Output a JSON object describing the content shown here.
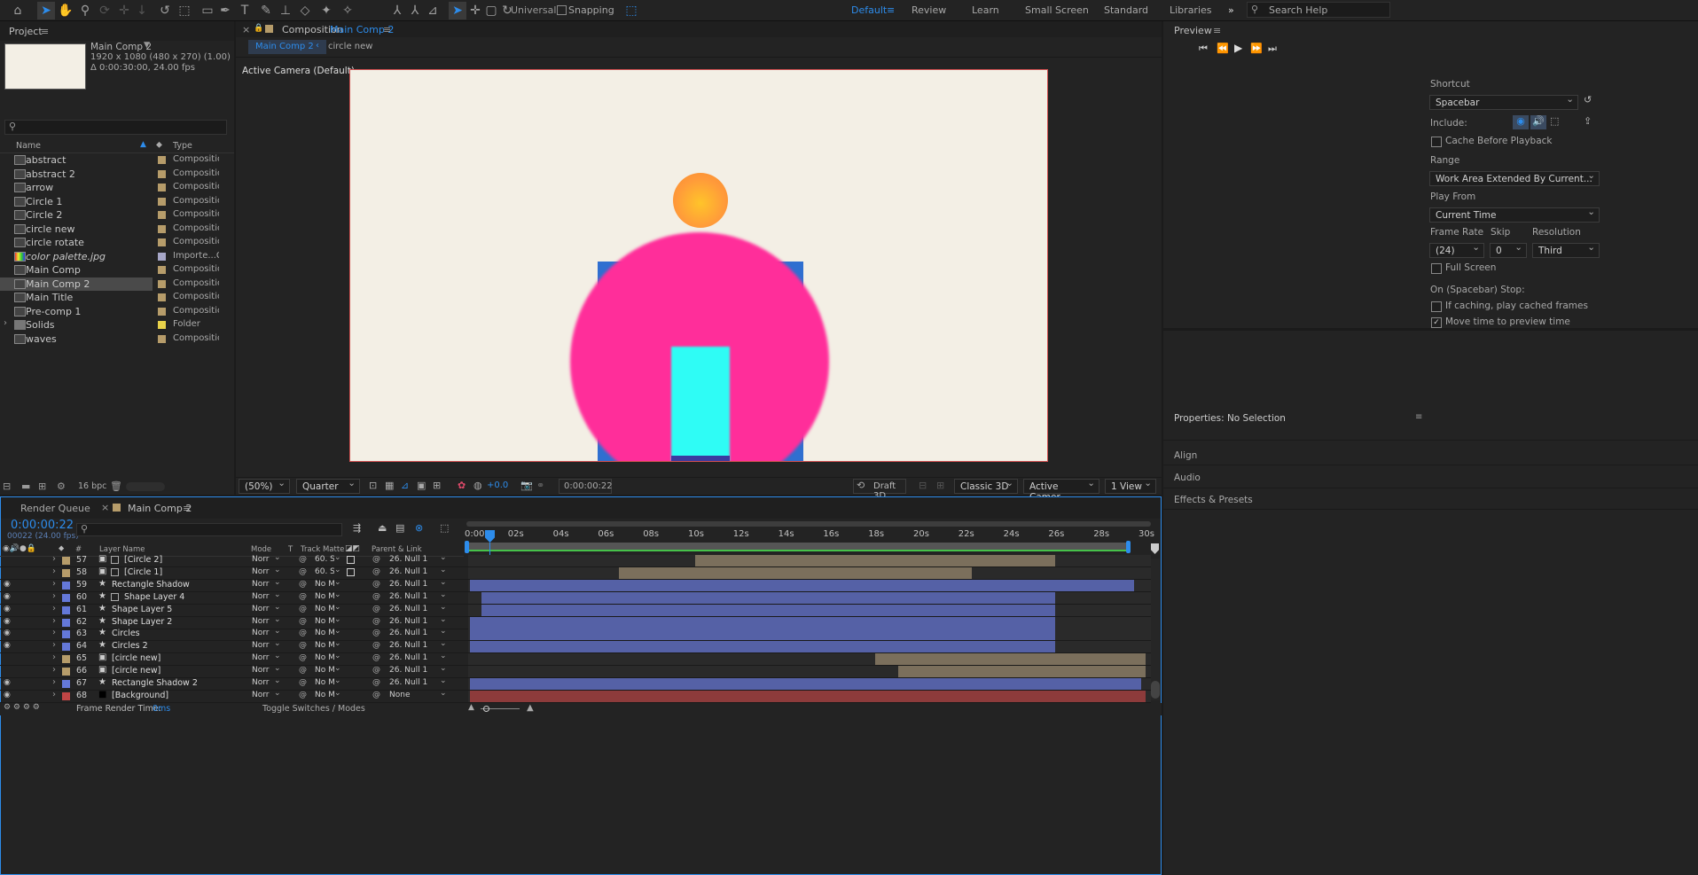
{
  "toolbar": {
    "mode_label": "Universal",
    "snapping_label": "Snapping",
    "workspaces": [
      "Default",
      "Review",
      "Learn",
      "Small Screen",
      "Standard",
      "Libraries"
    ],
    "search_placeholder": "Search Help"
  },
  "project": {
    "tab_label": "Project",
    "selected_name": "Main Comp 2",
    "selected_res": "1920 x 1080  (480 x 270) (1.00)",
    "selected_duration": "Δ 0:00:30:00, 24.00 fps",
    "col_name": "Name",
    "col_type": "Type",
    "items": [
      {
        "name": "abstract",
        "type": "Composition",
        "label_color": "#b69c6a"
      },
      {
        "name": "abstract 2",
        "type": "Composition",
        "label_color": "#b69c6a"
      },
      {
        "name": "arrow",
        "type": "Composition",
        "label_color": "#b69c6a"
      },
      {
        "name": "Circle 1",
        "type": "Composition",
        "label_color": "#b69c6a"
      },
      {
        "name": "Circle 2",
        "type": "Composition",
        "label_color": "#b69c6a"
      },
      {
        "name": "circle new",
        "type": "Composition",
        "label_color": "#b69c6a"
      },
      {
        "name": "circle rotate",
        "type": "Composition",
        "label_color": "#b69c6a"
      },
      {
        "name": "color palette.jpg",
        "type": "Importe...G",
        "label_color": "#a7a7c8"
      },
      {
        "name": "Main Comp",
        "type": "Composition",
        "label_color": "#b69c6a"
      },
      {
        "name": "Main Comp 2",
        "type": "Composition",
        "label_color": "#b69c6a"
      },
      {
        "name": "Main Title",
        "type": "Composition",
        "label_color": "#b69c6a"
      },
      {
        "name": "Pre-comp 1",
        "type": "Composition",
        "label_color": "#b69c6a"
      },
      {
        "name": "Solids",
        "type": "Folder",
        "label_color": "#e8d24a"
      },
      {
        "name": "waves",
        "type": "Composition",
        "label_color": "#b69c6a"
      }
    ],
    "bpc": "16 bpc"
  },
  "composition": {
    "tab_prefix": "Composition",
    "tab_name": "Main Comp 2",
    "breadcrumb_active": "Main Comp 2",
    "breadcrumb_next": "circle new",
    "camera_label": "Active Camera (Default)",
    "zoom": "(50%)",
    "resolution": "Quarter",
    "exposure": "+0.0",
    "timecode": "0:00:00:22",
    "draft3d": "Draft 3D",
    "renderer": "Classic 3D",
    "camera_select": "Active Camer...",
    "views": "1 View"
  },
  "preview": {
    "tab_label": "Preview",
    "shortcut_label": "Shortcut",
    "shortcut_value": "Spacebar",
    "include_label": "Include:",
    "cache_label": "Cache Before Playback",
    "range_label": "Range",
    "range_value": "Work Area Extended By Current...",
    "play_from_label": "Play From",
    "play_from_value": "Current Time",
    "frame_rate_label": "Frame Rate",
    "frame_rate_value": "(24)",
    "skip_label": "Skip",
    "skip_value": "0",
    "resolution_label": "Resolution",
    "resolution_value": "Third",
    "full_screen_label": "Full Screen",
    "on_stop_label": "On (Spacebar) Stop:",
    "if_caching_label": "If caching, play cached frames",
    "move_time_label": "Move time to preview time"
  },
  "properties": {
    "title": "Properties: No Selection",
    "sections": [
      "Align",
      "Audio",
      "Effects & Presets"
    ]
  },
  "timeline": {
    "tab_render_queue": "Render Queue",
    "tab_comp": "Main Comp 2",
    "timecode": "0:00:00:22",
    "frame_info": "00022 (24.00 fps)",
    "col_layer_name": "Layer Name",
    "col_mode": "Mode",
    "col_t": "T",
    "col_track_matte": "Track Matte",
    "col_parent": "Parent & Link",
    "ruler": [
      "0:00s",
      "02s",
      "04s",
      "06s",
      "08s",
      "10s",
      "12s",
      "14s",
      "16s",
      "18s",
      "20s",
      "22s",
      "24s",
      "26s",
      "28s",
      "30s"
    ],
    "layers": [
      {
        "num": "57",
        "name": "[Circle 2]",
        "mode": "Norr",
        "matte": "60. S",
        "parent": "26. Null 1",
        "label": "#b69c6a",
        "kind": "comp",
        "vis": false
      },
      {
        "num": "58",
        "name": "[Circle 1]",
        "mode": "Norr",
        "matte": "60. S",
        "parent": "26. Null 1",
        "label": "#b69c6a",
        "kind": "comp",
        "vis": false
      },
      {
        "num": "59",
        "name": "Rectangle Shadow",
        "mode": "Norr",
        "matte": "No M",
        "parent": "26. Null 1",
        "label": "#6478d8",
        "kind": "shape",
        "vis": true
      },
      {
        "num": "60",
        "name": "Shape Layer 4",
        "mode": "Norr",
        "matte": "No M",
        "parent": "26. Null 1",
        "label": "#6478d8",
        "kind": "shape",
        "vis": true
      },
      {
        "num": "61",
        "name": "Shape Layer 5",
        "mode": "Norr",
        "matte": "No M",
        "parent": "26. Null 1",
        "label": "#6478d8",
        "kind": "shape",
        "vis": true
      },
      {
        "num": "62",
        "name": "Shape Layer 2",
        "mode": "Norr",
        "matte": "No M",
        "parent": "26. Null 1",
        "label": "#6478d8",
        "kind": "shape",
        "vis": true
      },
      {
        "num": "63",
        "name": "Circles",
        "mode": "Norr",
        "matte": "No M",
        "parent": "26. Null 1",
        "label": "#6478d8",
        "kind": "shape",
        "vis": true
      },
      {
        "num": "64",
        "name": "Circles 2",
        "mode": "Norr",
        "matte": "No M",
        "parent": "26. Null 1",
        "label": "#6478d8",
        "kind": "shape",
        "vis": true
      },
      {
        "num": "65",
        "name": "[circle new]",
        "mode": "Norr",
        "matte": "No M",
        "parent": "26. Null 1",
        "label": "#b69c6a",
        "kind": "comp",
        "vis": false
      },
      {
        "num": "66",
        "name": "[circle new]",
        "mode": "Norr",
        "matte": "No M",
        "parent": "26. Null 1",
        "label": "#b69c6a",
        "kind": "comp",
        "vis": false
      },
      {
        "num": "67",
        "name": "Rectangle Shadow 2",
        "mode": "Norr",
        "matte": "No M",
        "parent": "26. Null 1",
        "label": "#6478d8",
        "kind": "shape",
        "vis": true
      },
      {
        "num": "68",
        "name": "[Background]",
        "mode": "Norr",
        "matte": "No M",
        "parent": "None",
        "label": "#c04545",
        "kind": "solid",
        "vis": true
      }
    ],
    "frame_render_label": "Frame Render Time:",
    "frame_render_value": "0ms",
    "toggle_label": "Toggle Switches / Modes"
  },
  "colors": {
    "accent": "#2d8ceb",
    "comp_bg": "#f3efe5",
    "pink": "#ff2e9a",
    "cyan": "#2ffcf5",
    "blue": "#2f6fd0",
    "orange": "#ff9a3a",
    "bar_comp": "#7b6f5c",
    "bar_shape": "#5561a6",
    "bar_solid": "#8d3b3b"
  }
}
